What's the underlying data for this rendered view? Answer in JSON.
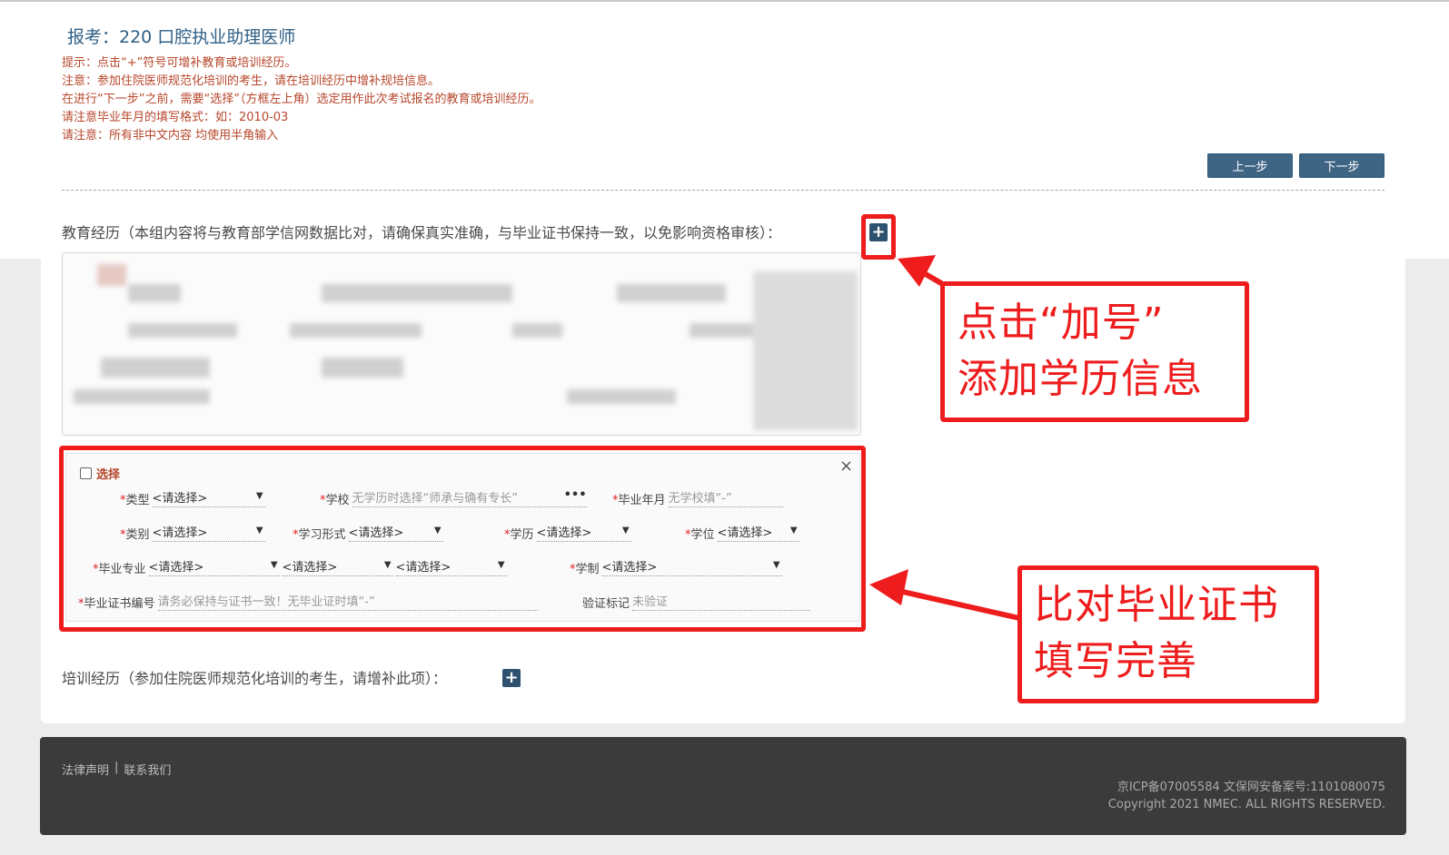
{
  "header": {
    "title": "报考：220 口腔执业助理医师",
    "notes": [
      "提示：点击“+”符号可增补教育或培训经历。",
      "注意：参加住院医师规范化培训的考生，请在培训经历中增补规培信息。",
      "在进行“下一步”之前，需要“选择”（方框左上角）选定用作此次考试报名的教育或培训经历。",
      "请注意毕业年月的填写格式：如：2010-03",
      "请注意：所有非中文内容 均使用半角输入"
    ],
    "prev_label": "上一步",
    "next_label": "下一步"
  },
  "education": {
    "label": "教育经历（本组内容将与教育部学信网数据比对，请确保真实准确，与毕业证书保持一致，以免影响资格审核）：",
    "add_glyph": "+"
  },
  "form": {
    "select_label": "选择",
    "close_glyph": "×",
    "required_mark": "*",
    "type_label": "类型",
    "type_value": "<请选择>",
    "school_label": "学校",
    "school_placeholder": "无学历时选择“师承与确有专长”",
    "grad_date_label": "毕业年月",
    "grad_date_placeholder": "无学校填“-”",
    "category_label": "类别",
    "category_value": "<请选择>",
    "study_mode_label": "学习形式",
    "study_mode_value": "<请选择>",
    "degree_edu_label": "学历",
    "degree_edu_value": "<请选择>",
    "degree_label": "学位",
    "degree_value": "<请选择>",
    "major_label": "毕业专业",
    "major_values": [
      "<请选择>",
      "<请选择>",
      "<请选择>"
    ],
    "duration_label": "学制",
    "duration_value": "<请选择>",
    "cert_no_label": "毕业证书编号",
    "cert_no_placeholder": "请务必保持与证书一致！无毕业证时填“-”",
    "verify_label": "验证标记",
    "verify_value": "未验证",
    "more_glyph": "•••"
  },
  "training": {
    "label": "培训经历（参加住院医师规范化培训的考生，请增补此项）：",
    "add_glyph": "+"
  },
  "annotations": {
    "callout_add": [
      "点击“加号”",
      "添加学历信息"
    ],
    "callout_cert": [
      "比对毕业证书",
      "填写完善"
    ],
    "color": "#ee1c1c"
  },
  "footer": {
    "legal": "法律声明",
    "separator": "|",
    "contact": "联系我们",
    "icp": "京ICP备07005584 文保网安备案号:1101080075",
    "copyright": "Copyright 2021 NMEC. ALL RIGHTS RESERVED."
  },
  "colors": {
    "primary_button": "#3f6585",
    "note_text": "#b7462b",
    "title_text": "#2e5f86",
    "footer_bg": "#3b3b3b"
  }
}
